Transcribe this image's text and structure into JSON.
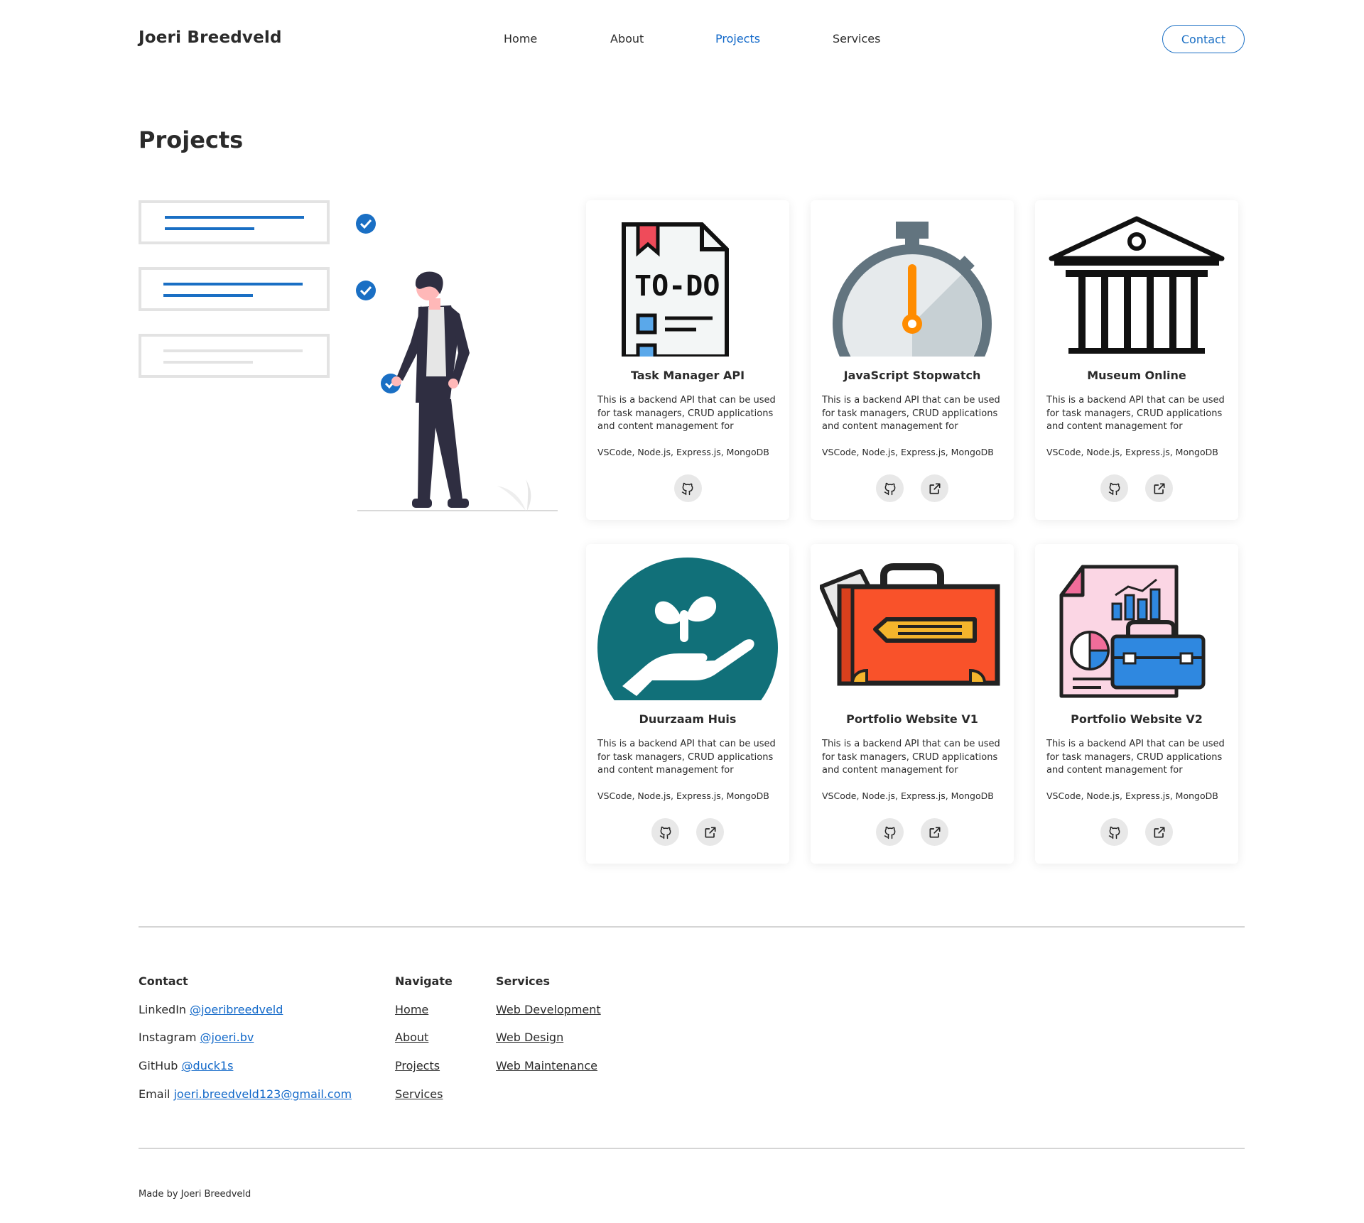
{
  "header": {
    "brand": "Joeri Breedveld",
    "nav": [
      "Home",
      "About",
      "Projects",
      "Services"
    ],
    "active_nav": "Projects",
    "contact_label": "Contact"
  },
  "page": {
    "title": "Projects"
  },
  "projects": [
    {
      "title": "Task Manager API",
      "description": "This is a backend API that can be used for task managers, CRUD applications and content management for",
      "tech": "VSCode, Node.js, Express.js, MongoDB",
      "image": "todo-list-icon",
      "links": [
        "github-icon"
      ]
    },
    {
      "title": "JavaScript Stopwatch",
      "description": "This is a backend API that can be used for task managers, CRUD applications and content management for",
      "tech": "VSCode, Node.js, Express.js, MongoDB",
      "image": "stopwatch-icon",
      "links": [
        "github-icon",
        "external-link-icon"
      ]
    },
    {
      "title": "Museum Online",
      "description": "This is a backend API that can be used for task managers, CRUD applications and content management for",
      "tech": "VSCode, Node.js, Express.js, MongoDB",
      "image": "museum-icon",
      "links": [
        "github-icon",
        "external-link-icon"
      ]
    },
    {
      "title": "Duurzaam Huis",
      "description": "This is a backend API that can be used for task managers, CRUD applications and content management for",
      "tech": "VSCode, Node.js, Express.js, MongoDB",
      "image": "plant-hand-icon",
      "links": [
        "github-icon",
        "external-link-icon"
      ]
    },
    {
      "title": "Portfolio Website V1",
      "description": "This is a backend API that can be used for task managers, CRUD applications and content management for",
      "tech": "VSCode, Node.js, Express.js, MongoDB",
      "image": "briefcase-pencil-icon",
      "links": [
        "github-icon",
        "external-link-icon"
      ]
    },
    {
      "title": "Portfolio Website V2",
      "description": "This is a backend API that can be used for task managers, CRUD applications and content management for",
      "tech": "VSCode, Node.js, Express.js, MongoDB",
      "image": "report-briefcase-icon",
      "links": [
        "github-icon",
        "external-link-icon"
      ]
    }
  ],
  "footer": {
    "contact": {
      "heading": "Contact",
      "rows": [
        {
          "label": "LinkedIn",
          "value": "@joeribreedveld"
        },
        {
          "label": "Instagram",
          "value": "@joeri.bv"
        },
        {
          "label": "GitHub",
          "value": "@duck1s"
        },
        {
          "label": "Email",
          "value": "joeri.breedveld123@gmail.com"
        }
      ]
    },
    "navigate": {
      "heading": "Navigate",
      "links": [
        "Home",
        "About",
        "Projects",
        "Services"
      ]
    },
    "services": {
      "heading": "Services",
      "links": [
        "Web Development",
        "Web Design",
        "Web Maintenance"
      ]
    },
    "made_by": "Made by Joeri Breedveld"
  },
  "colors": {
    "accent": "#1168c9",
    "text": "#2b2b2b",
    "divider": "#d5d5d5",
    "icon_bg": "#e8e8e8"
  }
}
